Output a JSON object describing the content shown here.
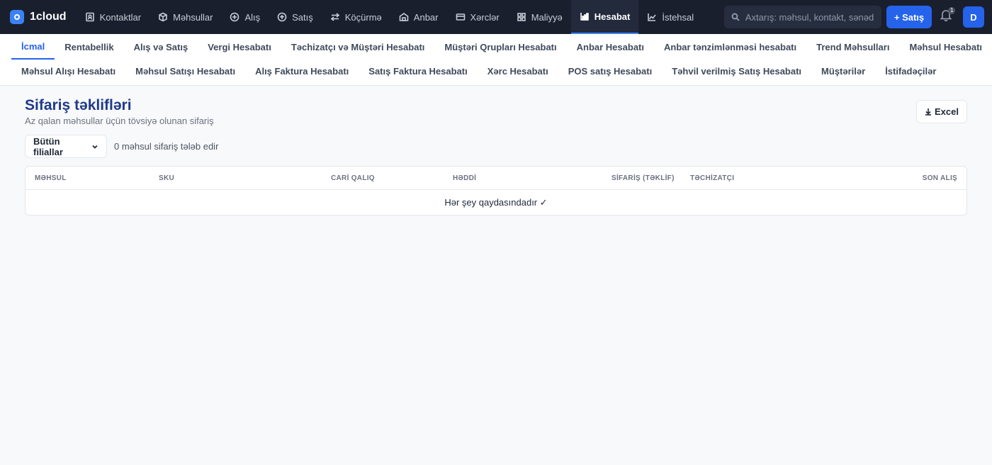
{
  "app": {
    "name": "1cloud"
  },
  "nav": {
    "items": [
      {
        "label": "Kontaktlar",
        "icon": "contacts-icon"
      },
      {
        "label": "Məhsullar",
        "icon": "box-icon"
      },
      {
        "label": "Alış",
        "icon": "arrow-circle-down-icon"
      },
      {
        "label": "Satış",
        "icon": "arrow-circle-up-icon"
      },
      {
        "label": "Köçürmə",
        "icon": "transfer-icon"
      },
      {
        "label": "Anbar",
        "icon": "warehouse-icon"
      },
      {
        "label": "Xərclər",
        "icon": "wallet-icon"
      },
      {
        "label": "Maliyyə",
        "icon": "grid-icon"
      },
      {
        "label": "Hesabat",
        "icon": "chart-icon",
        "active": true
      },
      {
        "label": "İstehsal",
        "icon": "factory-icon"
      }
    ],
    "search_placeholder": "Axtarış: məhsul, kontakt, sənəd...",
    "new_button": "+ Satış",
    "notification_count": "1",
    "avatar_initial": "D"
  },
  "tabs": {
    "row1": [
      "İcmal",
      "Rentabellik",
      "Alış və Satış",
      "Vergi Hesabatı",
      "Təchizatçı və Müştəri Hesabatı",
      "Müştəri Qrupları Hesabatı",
      "Anbar Hesabatı",
      "Anbar tənzimlənməsi hesabatı",
      "Trend Məhsulları",
      "Məhsul Hesabatı"
    ],
    "row2": [
      "Məhsul Alışı Hesabatı",
      "Məhsul Satışı Hesabatı",
      "Alış Faktura Hesabatı",
      "Satış Faktura Hesabatı",
      "Xərc Hesabatı",
      "POS satış Hesabatı",
      "Təhvil verilmiş Satış Hesabatı",
      "Müştərilər",
      "İstifadəçilər"
    ],
    "active": "İcmal"
  },
  "page": {
    "title": "Sifariş təklifləri",
    "subtitle": "Az qalan məhsullar üçün tövsiyə olunan sifariş",
    "excel_label": "Excel",
    "branch_select": "Bütün filiallar",
    "count_text": "0 məhsul sifariş tələb edir"
  },
  "table": {
    "columns": [
      "MƏHSUL",
      "SKU",
      "CARİ QALIQ",
      "HƏDDİ",
      "SİFARİŞ (TƏKLİF)",
      "TƏCHİZATÇI",
      "SON ALIŞ"
    ],
    "empty_message": "Hər şey qaydasındadır ✓"
  },
  "colors": {
    "accent": "#2563eb",
    "topbar": "#1a1f2e",
    "title": "#1e3a8a"
  }
}
